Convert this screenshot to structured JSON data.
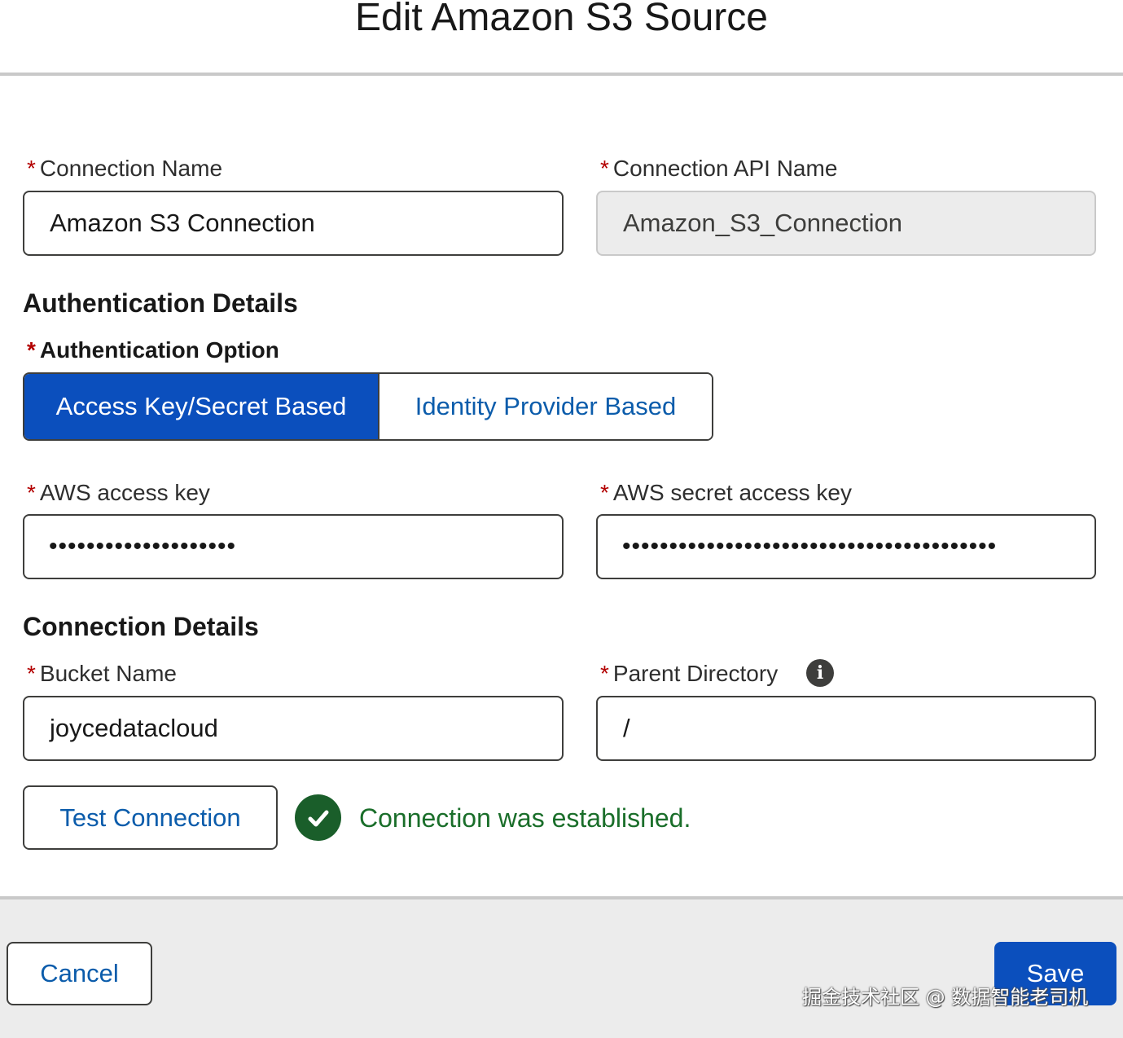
{
  "modal": {
    "title": "Edit Amazon S3 Source"
  },
  "required_marker": "*",
  "fields": {
    "connection_name": {
      "label": "Connection Name",
      "value": "Amazon S3 Connection"
    },
    "connection_api_name": {
      "label": "Connection API Name",
      "value": "Amazon_S3_Connection",
      "disabled": true
    },
    "aws_access_key": {
      "label": "AWS access key",
      "value": "••••••••••••••••••••"
    },
    "aws_secret_access_key": {
      "label": "AWS secret access key",
      "value": "••••••••••••••••••••••••••••••••••••••••"
    },
    "bucket_name": {
      "label": "Bucket Name",
      "value": "joycedatacloud"
    },
    "parent_directory": {
      "label": "Parent Directory",
      "value": "/",
      "info_icon": "info-icon"
    }
  },
  "auth_section": {
    "title": "Authentication Details",
    "option_label": "Authentication Option",
    "options": [
      {
        "label": "Access Key/Secret Based",
        "selected": true
      },
      {
        "label": "Identity Provider Based",
        "selected": false
      }
    ]
  },
  "connection_section": {
    "title": "Connection Details"
  },
  "test": {
    "button_label": "Test Connection",
    "status_icon": "check-circle-icon",
    "status_text": "Connection was established."
  },
  "footer": {
    "cancel_label": "Cancel",
    "save_label": "Save"
  },
  "watermark": "掘金技术社区 @ 数据智能老司机",
  "colors": {
    "brand": "#0b4fbd",
    "link": "#0b5cab",
    "success": "#1a6e2a",
    "required": "#b30000"
  }
}
